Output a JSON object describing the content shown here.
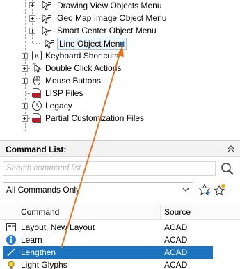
{
  "tree": {
    "items": [
      {
        "label": "Drawing View Objects Menu"
      },
      {
        "label": "Geo Map Image Object Menu"
      },
      {
        "label": "Smart Center Object Menu"
      },
      {
        "label": "Line Object Menu"
      },
      {
        "label": "Keyboard Shortcuts"
      },
      {
        "label": "Double Click Actions"
      },
      {
        "label": "Mouse Buttons"
      },
      {
        "label": "LISP Files"
      },
      {
        "label": "Legacy"
      },
      {
        "label": "Partial Customization Files"
      }
    ]
  },
  "command_list": {
    "title": "Command List:",
    "search_placeholder": "Search command list",
    "filter_value": "All Commands Only",
    "columns": {
      "command": "Command",
      "source": "Source"
    },
    "rows": [
      {
        "command": "Layout, New Layout",
        "source": "ACAD"
      },
      {
        "command": "Learn",
        "source": "ACAD"
      },
      {
        "command": "Lengthen",
        "source": "ACAD",
        "selected": true
      },
      {
        "command": "Light Glyphs",
        "source": "ACAD"
      }
    ]
  },
  "colors": {
    "selection": "#1e73be",
    "annotation_arrow": "#e8731f"
  }
}
